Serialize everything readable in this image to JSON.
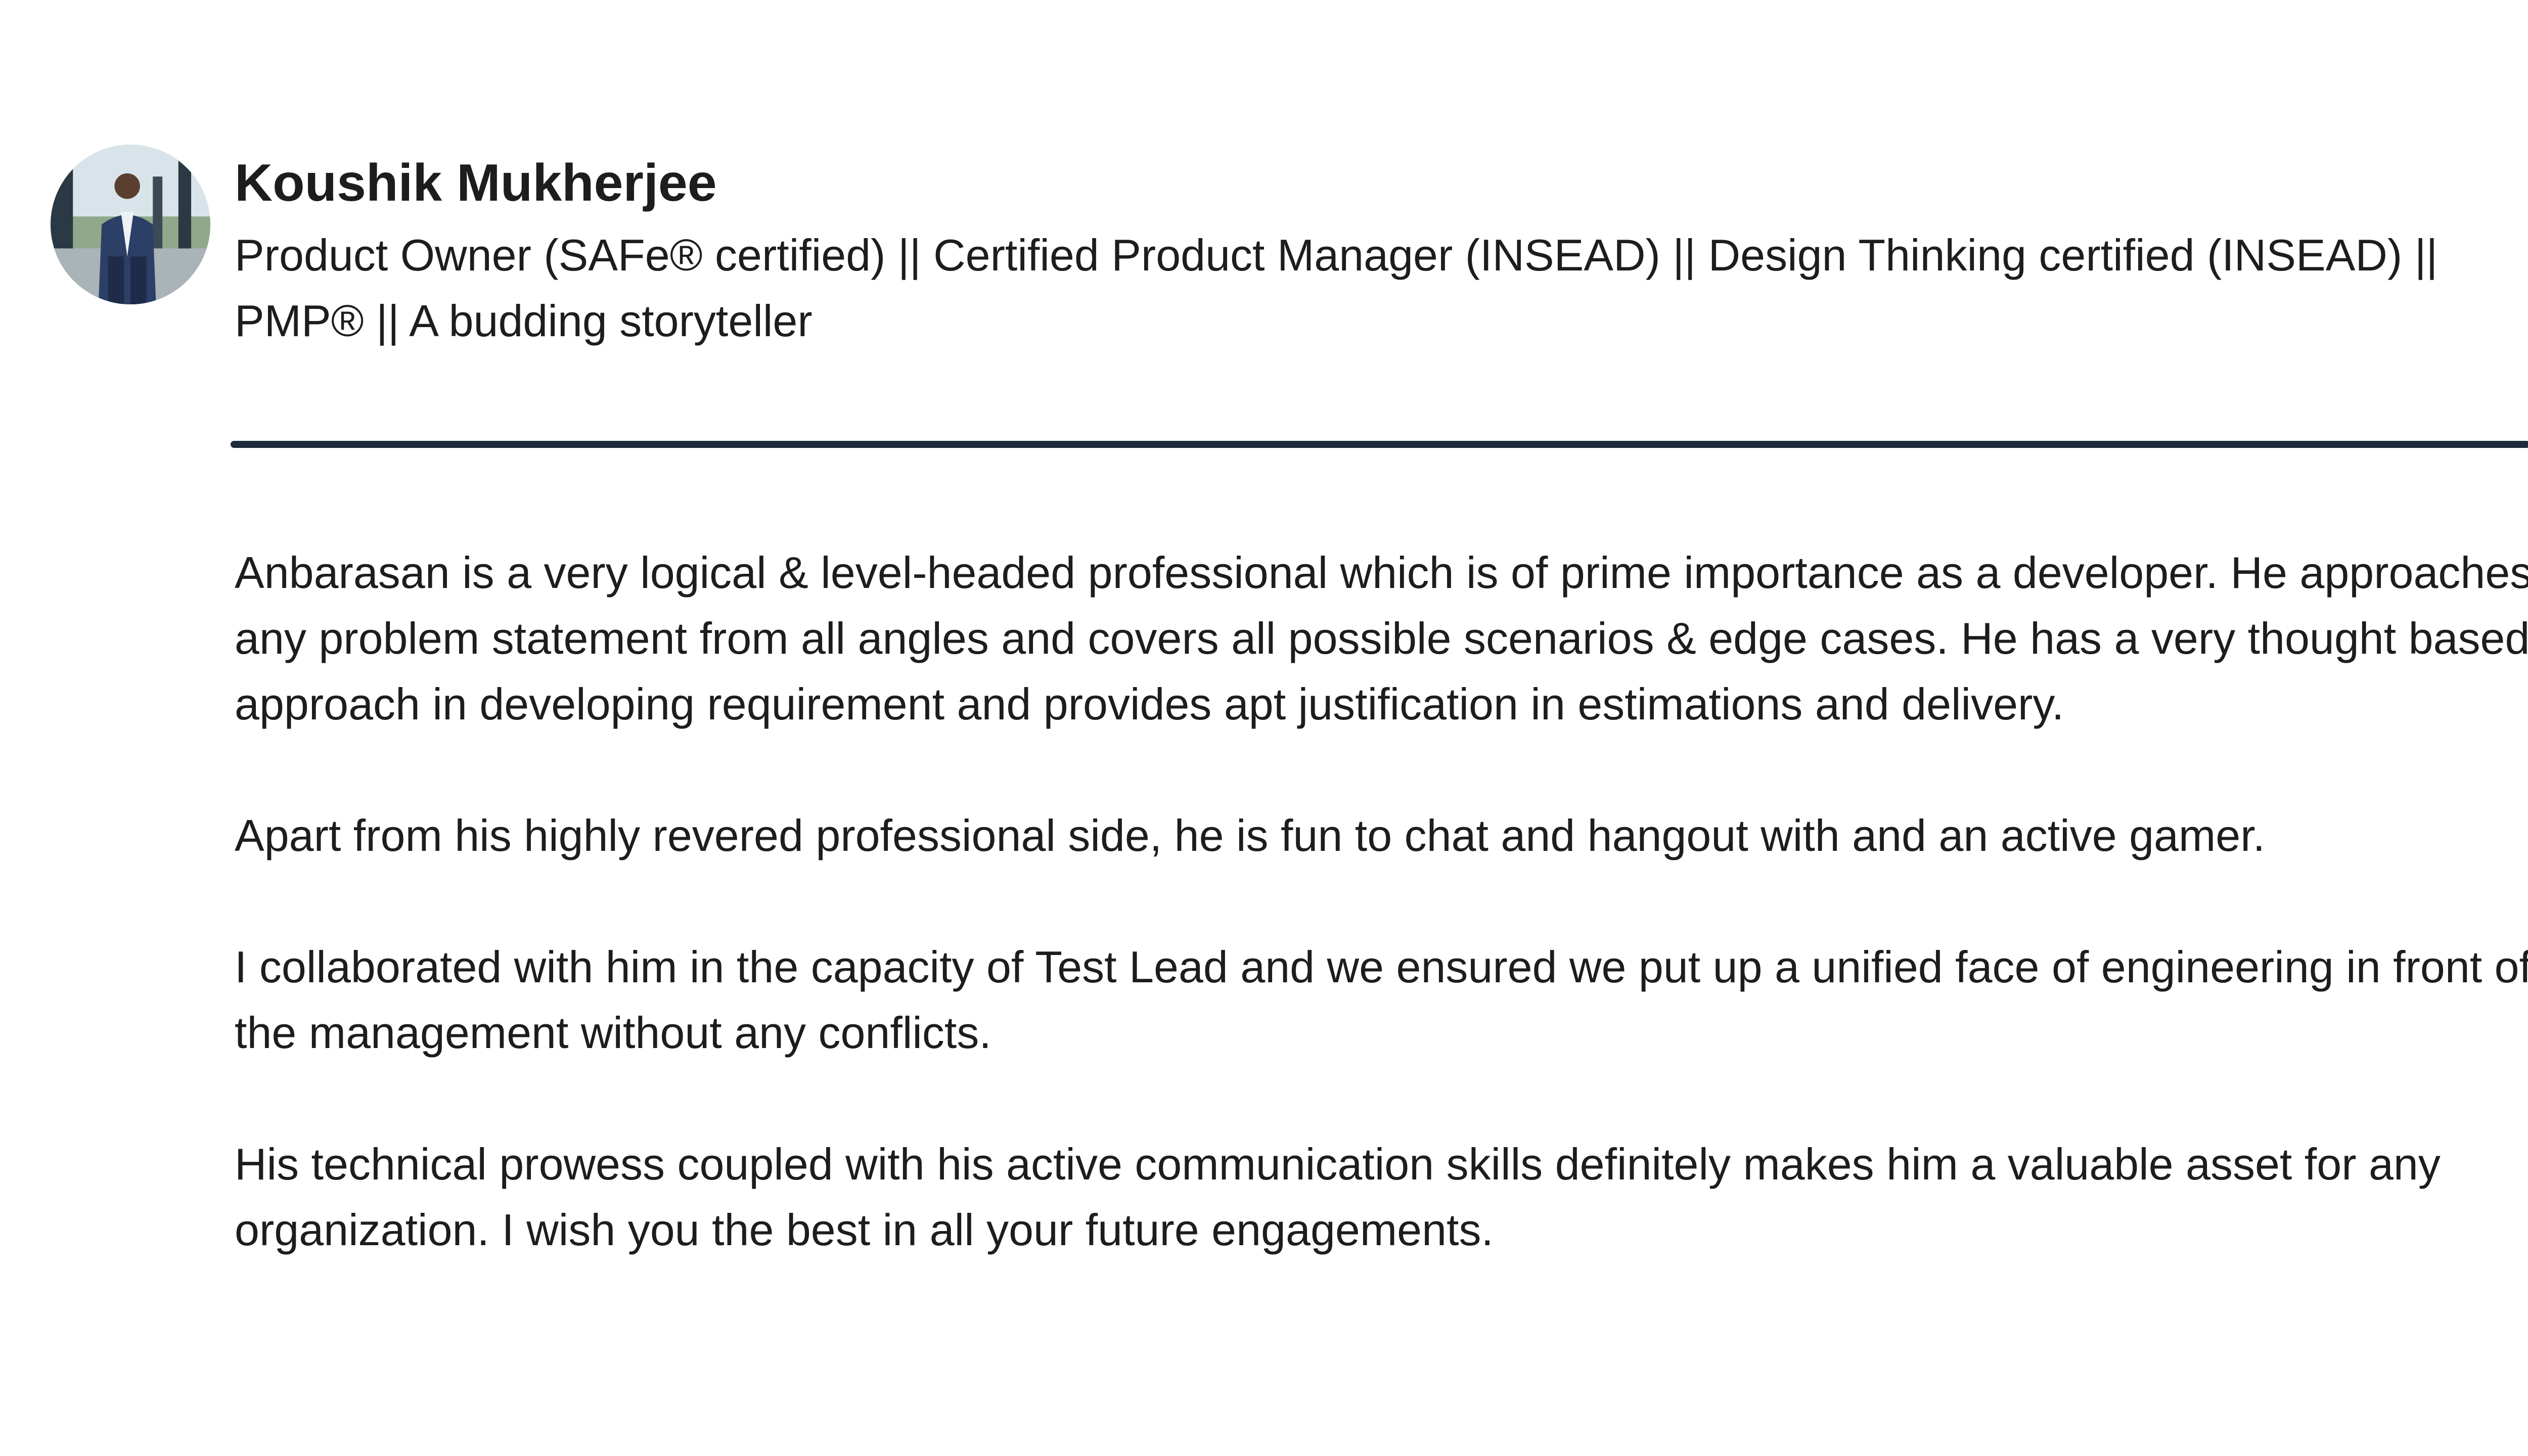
{
  "recommender": {
    "name": "Koushik Mukherjee",
    "headline": "Product Owner (SAFe® certified) || Certified Product Manager (INSEAD) || Design Thinking certified (INSEAD) || PMP® || A budding storyteller",
    "avatar_icon": "profile-photo"
  },
  "recommendation": {
    "paragraphs": [
      "Anbarasan is a very logical & level-headed professional which is of prime importance as a developer. He approaches any problem statement from all angles and covers all possible scenarios & edge cases. He has a very thought based approach in developing requirement and provides apt justification in estimations and delivery.",
      "Apart from his highly revered professional side, he is fun to chat and hangout with and an active gamer.",
      "I collaborated with him in the capacity of Test Lead and we ensured we put up a unified face of engineering in front of the management without any conflicts.",
      "His technical prowess coupled with his active communication skills definitely makes him a valuable asset for any organization. I wish you the best in all your future engagements."
    ]
  },
  "colors": {
    "text": "#1d1d1d",
    "divider": "#1d2b3a",
    "background": "#ffffff"
  }
}
